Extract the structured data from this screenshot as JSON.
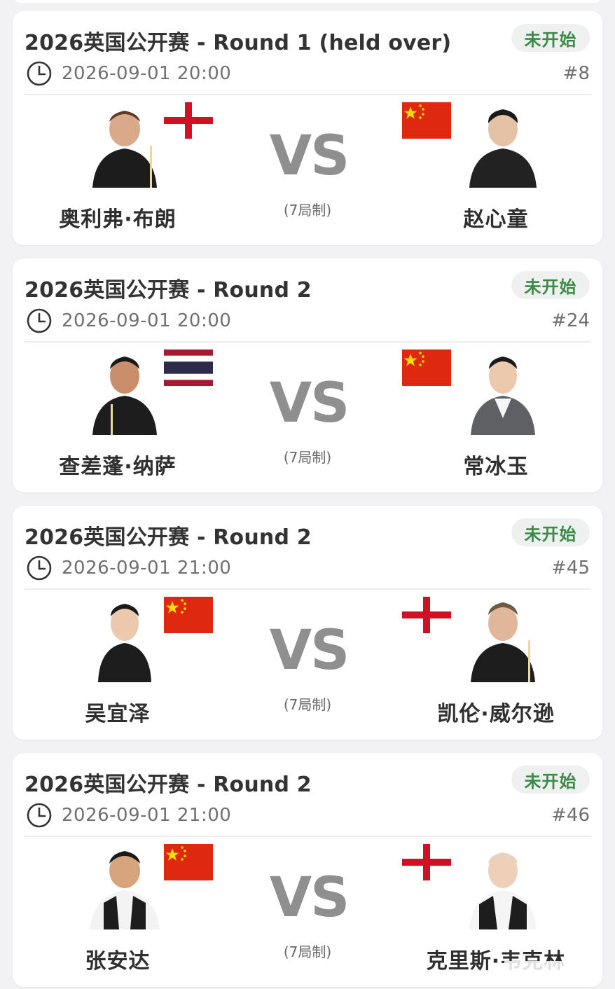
{
  "matches": [
    {
      "title": "2026英国公开赛 - Round 1 (held over)",
      "status": "未开始",
      "datetime": "2026-09-01 20:00",
      "match_number": "#8",
      "format": "(7局制)",
      "vs": "VS",
      "left_player": {
        "name": "奥利弗·布朗",
        "flag": "england",
        "portrait": "player-portrait"
      },
      "right_player": {
        "name": "赵心童",
        "flag": "china",
        "portrait": "player-portrait"
      }
    },
    {
      "title": "2026英国公开赛 - Round 2",
      "status": "未开始",
      "datetime": "2026-09-01 20:00",
      "match_number": "#24",
      "format": "(7局制)",
      "vs": "VS",
      "left_player": {
        "name": "查差蓬·纳萨",
        "flag": "thailand",
        "portrait": "player-portrait"
      },
      "right_player": {
        "name": "常冰玉",
        "flag": "china",
        "portrait": "player-portrait"
      }
    },
    {
      "title": "2026英国公开赛 - Round 2",
      "status": "未开始",
      "datetime": "2026-09-01 21:00",
      "match_number": "#45",
      "format": "(7局制)",
      "vs": "VS",
      "left_player": {
        "name": "吴宜泽",
        "flag": "china",
        "portrait": "player-portrait"
      },
      "right_player": {
        "name": "凯伦·威尔逊",
        "flag": "england",
        "portrait": "player-portrait"
      }
    },
    {
      "title": "2026英国公开赛 - Round 2",
      "status": "未开始",
      "datetime": "2026-09-01 21:00",
      "match_number": "#46",
      "format": "(7局制)",
      "vs": "VS",
      "left_player": {
        "name": "张安达",
        "flag": "china",
        "portrait": "player-portrait"
      },
      "right_player": {
        "name": "克里斯·韦克林",
        "flag": "england",
        "portrait": "player-portrait"
      }
    }
  ],
  "colors": {
    "status_text": "#3b8b47",
    "status_bg": "#eff0f0",
    "vs_text": "#8f8f8f",
    "england_red": "#ce1124",
    "china_red": "#de2910",
    "china_star": "#ffde00",
    "thai_red": "#a51931",
    "thai_blue": "#2d2a4a"
  }
}
